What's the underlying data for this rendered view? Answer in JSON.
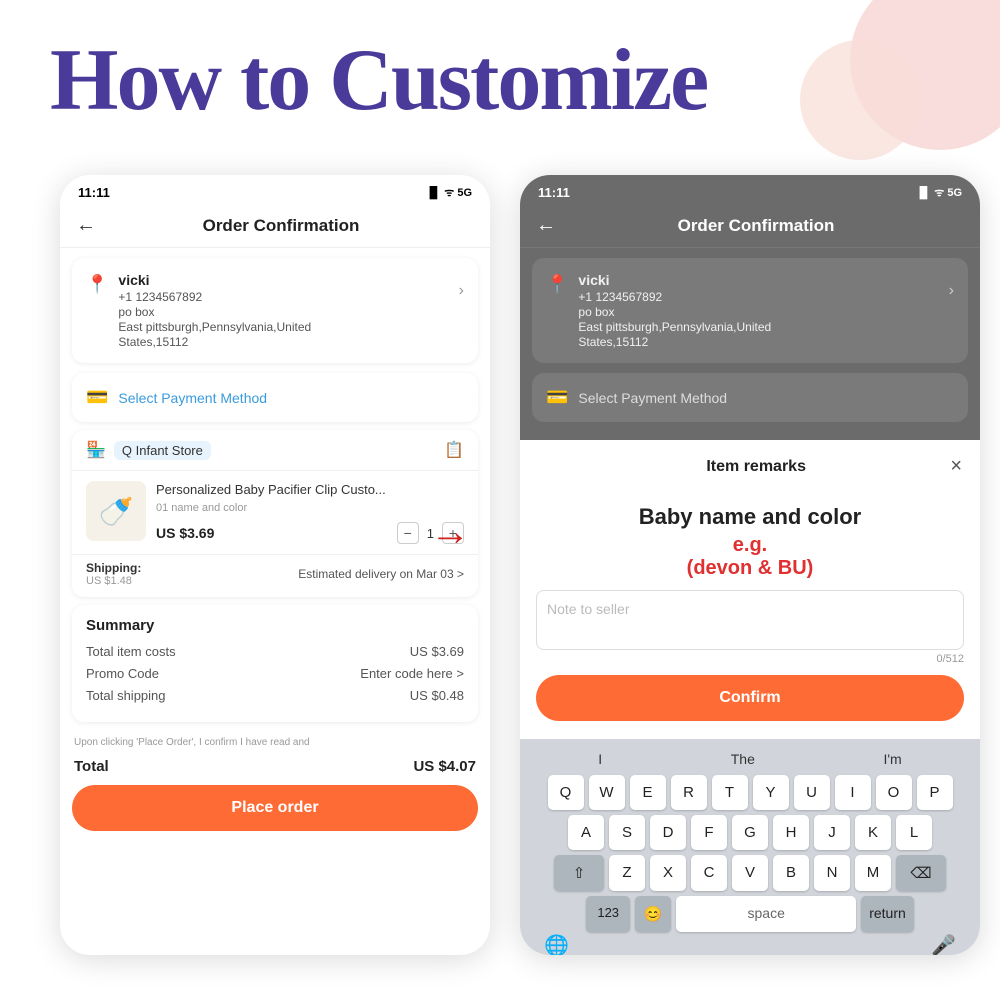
{
  "page": {
    "title": "How to Customize",
    "bg_circle1": "decorative",
    "bg_circle2": "decorative"
  },
  "left_phone": {
    "status_time": "11:11",
    "status_icons": "▐▌ ᯤ 5G",
    "nav_back": "←",
    "nav_title": "Order Confirmation",
    "address": {
      "name": "vicki",
      "phone": "+1 1234567892",
      "line1": "po box",
      "line2": "East pittsburgh,Pennsylvania,United",
      "line3": "States,15112"
    },
    "payment": {
      "label": "Select Payment Method"
    },
    "store": {
      "prefix": "Q",
      "name": "Infant Store"
    },
    "product": {
      "name": "Personalized Baby Pacifier Clip Custo...",
      "variant": "01 name and color",
      "price": "US $3.69",
      "qty": "1"
    },
    "shipping": {
      "label": "Shipping:",
      "price": "US $1.48",
      "delivery": "Estimated delivery on Mar 03 >"
    },
    "summary": {
      "title": "Summary",
      "item_costs_label": "Total item costs",
      "item_costs_value": "US $3.69",
      "promo_label": "Promo Code",
      "promo_value": "Enter code here >",
      "shipping_label": "Total shipping",
      "shipping_value": "US $0.48"
    },
    "terms": "Upon clicking 'Place Order', I confirm I have read and",
    "total_label": "Total",
    "total_value": "US $4.07",
    "place_order": "Place order"
  },
  "right_phone": {
    "status_time": "11:11",
    "status_icons": "▐▌ ᯤ 5G",
    "nav_back": "←",
    "nav_title": "Order Confirmation",
    "address": {
      "name": "vicki",
      "phone": "+1 1234567892",
      "line1": "po box",
      "line2": "East pittsburgh,Pennsylvania,United",
      "line3": "States,15112"
    },
    "payment": {
      "label": "Select Payment Method"
    },
    "remarks_modal": {
      "title": "Item remarks",
      "close": "×",
      "annotation_big": "Baby name and color",
      "annotation_eg": "e.g.",
      "annotation_eg2": "(devon & BU)",
      "placeholder": "Note to seller",
      "char_count": "0/512",
      "confirm_btn": "Confirm"
    },
    "keyboard": {
      "suggestions": [
        "I",
        "The",
        "I'm"
      ],
      "row1": [
        "Q",
        "W",
        "E",
        "R",
        "T",
        "Y",
        "U",
        "I",
        "O",
        "P"
      ],
      "row2": [
        "A",
        "S",
        "D",
        "F",
        "G",
        "H",
        "J",
        "K",
        "L"
      ],
      "row3": [
        "Z",
        "X",
        "C",
        "V",
        "B",
        "N",
        "M"
      ],
      "bottom": [
        "123",
        "😊",
        "space",
        "return"
      ]
    }
  }
}
